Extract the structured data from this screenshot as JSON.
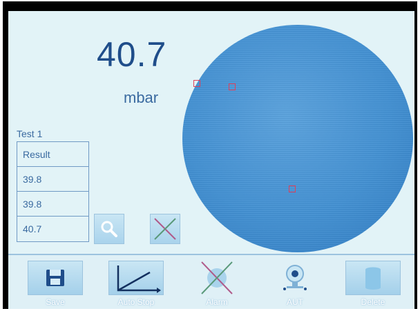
{
  "reading": {
    "value": "40.7",
    "unit": "mbar"
  },
  "test": {
    "label": "Test 1",
    "header": "Result",
    "results": [
      "39.8",
      "39.8",
      "40.7"
    ]
  },
  "controls": {
    "zoom_icon": "magnifier-icon",
    "clear_icon": "cross-icon"
  },
  "toolbar": {
    "items": [
      {
        "label": "Save",
        "icon": "floppy-disk-icon"
      },
      {
        "label": "Auto Stop",
        "icon": "ramp-graph-icon"
      },
      {
        "label": "Alarm",
        "icon": "alarm-muted-icon"
      },
      {
        "label": "AUT",
        "icon": "webcam-icon"
      },
      {
        "label": "Delete",
        "icon": "trash-can-icon"
      }
    ]
  },
  "colors": {
    "screen_background": "#e2f3f7",
    "disc": "#4290d2",
    "marker": "#e0405a",
    "reading_text": "#1f4d8a"
  }
}
